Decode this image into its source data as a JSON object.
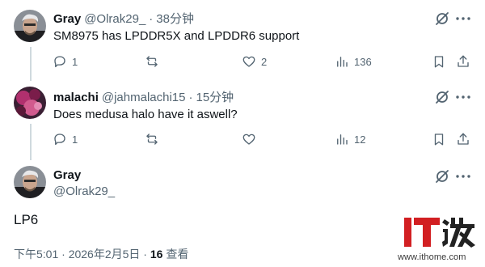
{
  "tweets": [
    {
      "name": "Gray",
      "handle": "@Olrak29_",
      "time": "38分钟",
      "text": "SM8975 has LPDDR5X and LPDDR6 support",
      "replies": "1",
      "likes": "2",
      "views": "136"
    },
    {
      "name": "malachi",
      "handle": "@jahmalachi15",
      "time": "15分钟",
      "text": "Does medusa halo have it aswell?",
      "replies": "1",
      "views": "12"
    }
  ],
  "main": {
    "name": "Gray",
    "handle": "@Olrak29_",
    "text": "LP6",
    "timestamp": "下午5:01 · 2026年2月5日 · ",
    "views_count": "16",
    "views_label": " 查看"
  },
  "watermark": {
    "logo": "IT之家",
    "url": "www.ithome.com"
  },
  "icons": {
    "grok": "grok-icon",
    "more": "more-icon",
    "reply": "reply-icon",
    "retweet": "retweet-icon",
    "like": "like-icon",
    "views": "views-icon",
    "bookmark": "bookmark-icon",
    "share": "share-icon"
  },
  "colors": {
    "text": "#0f1419",
    "secondary": "#536471",
    "thread_line": "#cfd9de",
    "watermark_red": "#d21f22"
  }
}
